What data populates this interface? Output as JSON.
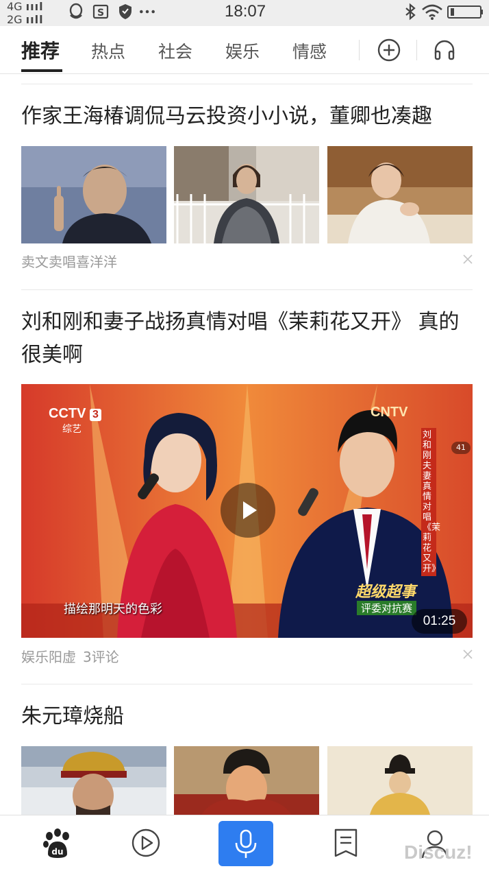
{
  "status_bar": {
    "network_top": "4G",
    "network_bottom": "2G",
    "time": "18:07",
    "icons": [
      "qq-icon",
      "s-app-icon",
      "shield-icon",
      "more-dots-icon",
      "bluetooth-icon",
      "wifi-icon",
      "battery-icon"
    ]
  },
  "tabs": [
    {
      "label": "推荐",
      "active": true
    },
    {
      "label": "热点",
      "active": false
    },
    {
      "label": "社会",
      "active": false
    },
    {
      "label": "娱乐",
      "active": false
    },
    {
      "label": "情感",
      "active": false
    }
  ],
  "tab_actions": {
    "add_icon": "plus-circle-icon",
    "listen_icon": "headphones-icon"
  },
  "feed": [
    {
      "title": "作家王海椿调侃马云投资小小说，董卿也凑趣",
      "source": "卖文卖唱喜洋洋",
      "comments": "",
      "type": "three-image"
    },
    {
      "title": "刘和刚和妻子战扬真情对唱《茉莉花又开》 真的很美啊",
      "source": "娱乐阳虚",
      "comments": "3评论",
      "type": "video",
      "video": {
        "duration": "01:25",
        "channel_logo": "CCTV",
        "channel_number": "3",
        "channel_name": "综艺",
        "right_logo": "CNTV",
        "subtitle": "描绘那明天的色彩",
        "vertical_caption": "刘和刚夫妻真情对唱《茉莉花又开》",
        "badge": "41",
        "show_logo": "超级超事",
        "show_tag": "评委对抗赛"
      }
    },
    {
      "title": "朱元璋烧船",
      "source": "",
      "comments": "",
      "type": "three-image"
    }
  ],
  "bottom_nav": [
    {
      "name": "home",
      "icon": "baidu-paw-icon"
    },
    {
      "name": "video",
      "icon": "play-circle-icon"
    },
    {
      "name": "voice",
      "icon": "microphone-icon"
    },
    {
      "name": "bookmark",
      "icon": "bookmark-icon"
    },
    {
      "name": "profile",
      "icon": "user-icon"
    }
  ],
  "watermark": "Discuz!",
  "colors": {
    "accent": "#2e7df0",
    "meta_text": "#999999",
    "headline": "#222222"
  }
}
